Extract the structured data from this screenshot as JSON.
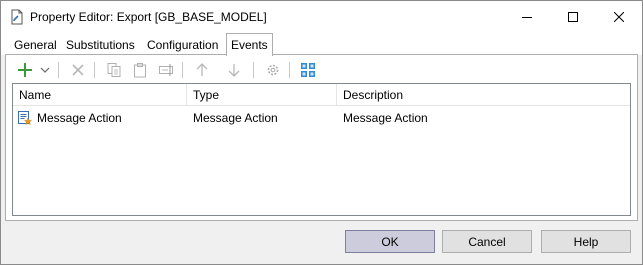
{
  "window": {
    "title": "Property Editor: Export [GB_BASE_MODEL]",
    "title_icon": "document-edit-icon",
    "controls": {
      "minimize": "minimize-icon",
      "maximize": "maximize-icon",
      "close": "close-icon"
    }
  },
  "tabs": [
    {
      "label": "General",
      "active": false
    },
    {
      "label": "Substitutions",
      "active": false
    },
    {
      "label": "Configuration",
      "active": false
    },
    {
      "label": "Events",
      "active": true
    }
  ],
  "toolbar": {
    "buttons": [
      {
        "icon": "add-icon",
        "enabled": true
      },
      {
        "icon": "dropdown-arrow-icon",
        "enabled": true
      },
      {
        "icon": "delete-icon",
        "enabled": false
      },
      {
        "icon": "copy-icon",
        "enabled": false
      },
      {
        "icon": "paste-icon",
        "enabled": false
      },
      {
        "icon": "rename-icon",
        "enabled": false
      },
      {
        "icon": "move-up-icon",
        "enabled": false
      },
      {
        "icon": "move-down-icon",
        "enabled": false
      },
      {
        "icon": "settings-icon",
        "enabled": false
      },
      {
        "icon": "grid-view-icon",
        "enabled": true
      }
    ],
    "accent_color": "#2f8bd6",
    "add_color": "#3c9a3c"
  },
  "list": {
    "columns": [
      "Name",
      "Type",
      "Description"
    ],
    "rows": [
      {
        "icon": "message-action-icon",
        "name": "Message Action",
        "type": "Message Action",
        "description": "Message Action"
      }
    ]
  },
  "buttons": {
    "ok": "OK",
    "cancel": "Cancel",
    "help": "Help"
  }
}
